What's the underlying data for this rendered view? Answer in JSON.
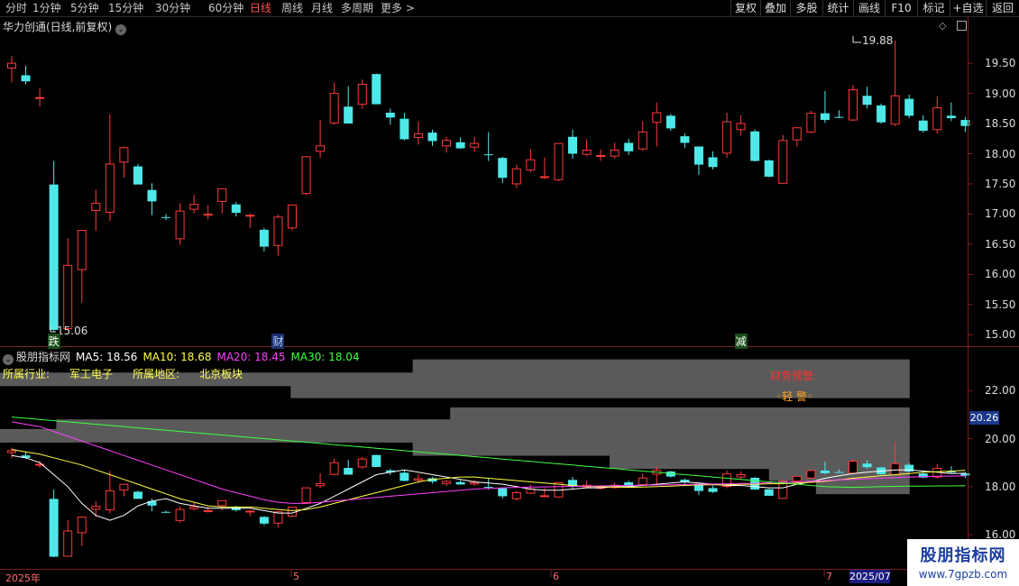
{
  "top_tabs": [
    {
      "label": "分时",
      "active": false
    },
    {
      "label": "1分钟",
      "active": false
    },
    {
      "label": "5分钟",
      "active": false
    },
    {
      "label": "15分钟",
      "active": false
    },
    {
      "label": "30分钟",
      "active": false
    },
    {
      "label": "60分钟",
      "active": false
    },
    {
      "label": "日线",
      "active": true
    },
    {
      "label": "周线",
      "active": false
    },
    {
      "label": "月线",
      "active": false
    },
    {
      "label": "多周期",
      "active": false
    },
    {
      "label": "更多 >",
      "active": false
    }
  ],
  "right_buttons": [
    "复权",
    "叠加",
    "多股",
    "统计",
    "画线",
    "F10",
    "标记",
    "+自选",
    "返回"
  ],
  "stock_title": "华力创通(日线,前复权)",
  "main_axis": [
    "19.50",
    "19.00",
    "18.50",
    "18.00",
    "17.50",
    "17.00",
    "16.50",
    "16.00",
    "15.50",
    "15.00"
  ],
  "high_label": "19.88",
  "low_label": "15.06",
  "events": [
    {
      "label": "跌",
      "color": "#40ff40"
    },
    {
      "label": "财",
      "color": "#6fa0ff"
    },
    {
      "label": "减",
      "color": "#40ff40"
    }
  ],
  "indicator": {
    "name": "股朋指标网",
    "ma5": "MA5: 18.56",
    "ma10": "MA10: 18.68",
    "ma20": "MA20: 18.45",
    "ma30": "MA30: 18.04"
  },
  "industry_label": "所属行业:",
  "industry_value": "军工电子",
  "region_label": "所属地区:",
  "region_value": "北京板块",
  "warning": "财务预警:",
  "warning_level": "◦轻 警◦",
  "sub_axis": [
    "22.00",
    "20.00",
    "18.00",
    "16.00"
  ],
  "current_price_tag": "20.26",
  "dates": [
    "2025年",
    "5",
    "6",
    "7"
  ],
  "date_box": "2025/07",
  "watermark": {
    "title": "股朋指标网",
    "url": "www.7gpzb.com"
  },
  "colors": {
    "up": "#ff3a3a",
    "down": "#4fe8e8",
    "ma5": "#ffffff",
    "ma10": "#ffff40",
    "ma20": "#ff40ff",
    "ma30": "#40ff40"
  },
  "chart_data": {
    "type": "candlestick",
    "ohlc": [
      [
        19.42,
        19.62,
        19.18,
        19.5
      ],
      [
        19.3,
        19.46,
        19.15,
        19.2
      ],
      [
        18.93,
        19.08,
        18.78,
        18.93
      ],
      [
        17.49,
        17.88,
        15.06,
        15.08
      ],
      [
        15.1,
        16.6,
        15.08,
        16.15
      ],
      [
        16.08,
        16.73,
        15.53,
        16.73
      ],
      [
        17.06,
        17.4,
        16.72,
        17.18
      ],
      [
        17.03,
        18.65,
        16.89,
        17.83
      ],
      [
        17.86,
        18.12,
        17.6,
        18.1
      ],
      [
        17.79,
        17.83,
        17.52,
        17.49
      ],
      [
        17.4,
        17.51,
        16.98,
        17.21
      ],
      [
        16.95,
        17.0,
        16.9,
        16.94
      ],
      [
        16.59,
        17.18,
        16.49,
        17.05
      ],
      [
        17.08,
        17.32,
        17.01,
        17.16
      ],
      [
        16.98,
        17.15,
        16.91,
        17.0
      ],
      [
        17.21,
        17.4,
        17.01,
        17.42
      ],
      [
        17.16,
        17.2,
        16.96,
        17.02
      ],
      [
        16.98,
        17.01,
        16.77,
        16.98
      ],
      [
        16.74,
        16.77,
        16.38,
        16.46
      ],
      [
        16.48,
        16.99,
        16.31,
        16.95
      ],
      [
        16.77,
        17.16,
        16.73,
        17.15
      ],
      [
        17.34,
        17.96,
        17.31,
        17.95
      ],
      [
        18.04,
        18.56,
        17.93,
        18.13
      ],
      [
        18.51,
        19.18,
        18.48,
        19.0
      ],
      [
        18.78,
        19.12,
        18.51,
        18.5
      ],
      [
        18.82,
        19.23,
        18.74,
        19.15
      ],
      [
        19.32,
        19.33,
        18.82,
        18.82
      ],
      [
        18.68,
        18.75,
        18.48,
        18.6
      ],
      [
        18.58,
        18.68,
        18.22,
        18.24
      ],
      [
        18.27,
        18.54,
        18.15,
        18.33
      ],
      [
        18.35,
        18.4,
        18.13,
        18.21
      ],
      [
        18.13,
        18.28,
        18.02,
        18.22
      ],
      [
        18.19,
        18.27,
        18.08,
        18.09
      ],
      [
        18.11,
        18.28,
        18.03,
        18.17
      ],
      [
        17.99,
        18.36,
        17.88,
        17.98
      ],
      [
        17.93,
        17.95,
        17.51,
        17.6
      ],
      [
        17.5,
        17.82,
        17.43,
        17.75
      ],
      [
        17.73,
        18.08,
        17.69,
        17.9
      ],
      [
        17.62,
        17.94,
        17.58,
        17.62
      ],
      [
        17.57,
        18.18,
        17.54,
        18.17
      ],
      [
        18.28,
        18.4,
        17.92,
        18.0
      ],
      [
        17.99,
        18.24,
        17.96,
        18.06
      ],
      [
        17.96,
        18.07,
        17.88,
        17.97
      ],
      [
        17.96,
        18.18,
        17.92,
        18.06
      ],
      [
        18.18,
        18.25,
        17.98,
        18.04
      ],
      [
        18.08,
        18.54,
        18.05,
        18.36
      ],
      [
        18.52,
        18.85,
        18.12,
        18.68
      ],
      [
        18.63,
        18.66,
        18.38,
        18.42
      ],
      [
        18.29,
        18.34,
        18.1,
        18.18
      ],
      [
        18.12,
        18.12,
        17.65,
        17.82
      ],
      [
        17.94,
        18.04,
        17.74,
        17.78
      ],
      [
        18.01,
        18.68,
        17.93,
        18.53
      ],
      [
        18.4,
        18.64,
        18.3,
        18.5
      ],
      [
        18.37,
        18.4,
        17.87,
        17.88
      ],
      [
        17.89,
        17.9,
        17.61,
        17.62
      ],
      [
        17.51,
        18.31,
        17.53,
        18.22
      ],
      [
        18.23,
        18.39,
        18.12,
        18.43
      ],
      [
        18.36,
        18.71,
        18.34,
        18.67
      ],
      [
        18.67,
        19.04,
        18.51,
        18.56
      ],
      [
        18.61,
        18.72,
        18.59,
        18.6
      ],
      [
        18.56,
        19.14,
        18.54,
        19.06
      ],
      [
        18.96,
        19.11,
        18.75,
        18.81
      ],
      [
        18.8,
        18.83,
        18.5,
        18.52
      ],
      [
        18.49,
        19.88,
        18.46,
        18.96
      ],
      [
        18.91,
        18.98,
        18.59,
        18.63
      ],
      [
        18.55,
        18.64,
        18.35,
        18.38
      ],
      [
        18.4,
        18.95,
        18.34,
        18.76
      ],
      [
        18.63,
        18.85,
        18.54,
        18.59
      ],
      [
        18.56,
        18.61,
        18.36,
        18.46
      ]
    ],
    "axis_range": [
      14.9,
      19.95
    ],
    "ma": {
      "ma5": [
        19.3,
        19.2,
        19.0,
        18.5,
        18.0,
        17.3,
        16.8,
        16.6,
        16.8,
        17.2,
        17.4,
        17.5,
        17.3,
        17.2,
        17.1,
        17.1,
        17.1,
        17.1,
        17.0,
        16.9,
        16.9,
        17.1,
        17.3,
        17.6,
        17.9,
        18.2,
        18.5,
        18.6,
        18.7,
        18.6,
        18.5,
        18.4,
        18.3,
        18.2,
        18.15,
        18.1,
        18.0,
        17.9,
        17.85,
        17.85,
        17.9,
        17.95,
        17.95,
        18.0,
        18.0,
        18.05,
        18.1,
        18.15,
        18.2,
        18.15,
        18.1,
        18.05,
        18.05,
        18.0,
        17.95,
        17.95,
        18.1,
        18.2,
        18.35,
        18.45,
        18.55,
        18.6,
        18.65,
        18.7,
        18.7,
        18.65,
        18.6,
        18.55,
        18.56
      ],
      "ma10": [
        19.55,
        19.45,
        19.35,
        19.2,
        19.05,
        18.9,
        18.7,
        18.5,
        18.3,
        18.1,
        17.9,
        17.7,
        17.5,
        17.35,
        17.2,
        17.15,
        17.15,
        17.15,
        17.1,
        17.05,
        17.0,
        17.05,
        17.15,
        17.3,
        17.45,
        17.6,
        17.75,
        17.9,
        18.05,
        18.2,
        18.3,
        18.35,
        18.4,
        18.4,
        18.35,
        18.3,
        18.25,
        18.2,
        18.15,
        18.1,
        18.05,
        18.0,
        18.0,
        17.98,
        17.97,
        17.98,
        18.0,
        18.02,
        18.05,
        18.07,
        18.08,
        18.08,
        18.1,
        18.1,
        18.12,
        18.12,
        18.15,
        18.18,
        18.22,
        18.28,
        18.35,
        18.4,
        18.45,
        18.5,
        18.55,
        18.6,
        18.62,
        18.65,
        18.68
      ],
      "ma20": [
        20.7,
        20.6,
        20.5,
        20.3,
        20.1,
        19.9,
        19.7,
        19.5,
        19.3,
        19.1,
        18.9,
        18.7,
        18.5,
        18.3,
        18.1,
        17.9,
        17.75,
        17.6,
        17.45,
        17.35,
        17.3,
        17.3,
        17.35,
        17.4,
        17.45,
        17.5,
        17.55,
        17.6,
        17.65,
        17.7,
        17.75,
        17.8,
        17.85,
        17.9,
        17.92,
        17.95,
        17.97,
        17.98,
        17.99,
        18.0,
        18.01,
        18.02,
        18.03,
        18.04,
        18.05,
        18.06,
        18.07,
        18.08,
        18.09,
        18.1,
        18.11,
        18.12,
        18.13,
        18.14,
        18.16,
        18.18,
        18.2,
        18.22,
        18.25,
        18.28,
        18.3,
        18.33,
        18.35,
        18.38,
        18.4,
        18.42,
        18.43,
        18.44,
        18.45
      ],
      "ma30": [
        20.9,
        20.85,
        20.8,
        20.75,
        20.7,
        20.65,
        20.6,
        20.55,
        20.5,
        20.45,
        20.4,
        20.35,
        20.3,
        20.25,
        20.2,
        20.15,
        20.1,
        20.05,
        20.0,
        19.95,
        19.9,
        19.85,
        19.8,
        19.75,
        19.7,
        19.65,
        19.6,
        19.55,
        19.5,
        19.45,
        19.4,
        19.35,
        19.3,
        19.25,
        19.2,
        19.15,
        19.1,
        19.05,
        19.0,
        18.95,
        18.9,
        18.85,
        18.8,
        18.75,
        18.7,
        18.65,
        18.6,
        18.55,
        18.5,
        18.45,
        18.4,
        18.35,
        18.3,
        18.25,
        18.2,
        18.15,
        18.1,
        18.05,
        18.0,
        17.98,
        17.97,
        17.98,
        18.0,
        18.01,
        18.02,
        18.02,
        18.03,
        18.03,
        18.04
      ]
    },
    "sub_axis_range": [
      14.8,
      23.1
    ],
    "bars": [
      {
        "y": 23.0,
        "left": 0.44,
        "right": 0.97
      },
      {
        "y": 22.45,
        "left": 0.0,
        "right": 0.97
      },
      {
        "y": 21.95,
        "left": 0.31,
        "right": 0.97
      },
      {
        "y": 21.0,
        "left": 0.48,
        "right": 0.97
      },
      {
        "y": 20.5,
        "left": 0.06,
        "right": 0.97
      },
      {
        "y": 20.1,
        "left": 0.0,
        "right": 0.97
      },
      {
        "y": 19.55,
        "left": 0.44,
        "right": 0.97
      },
      {
        "y": 19.0,
        "left": 0.65,
        "right": 0.97
      },
      {
        "y": 18.5,
        "left": 0.82,
        "right": 0.97
      },
      {
        "y": 17.95,
        "left": 0.87,
        "right": 0.97
      }
    ]
  }
}
